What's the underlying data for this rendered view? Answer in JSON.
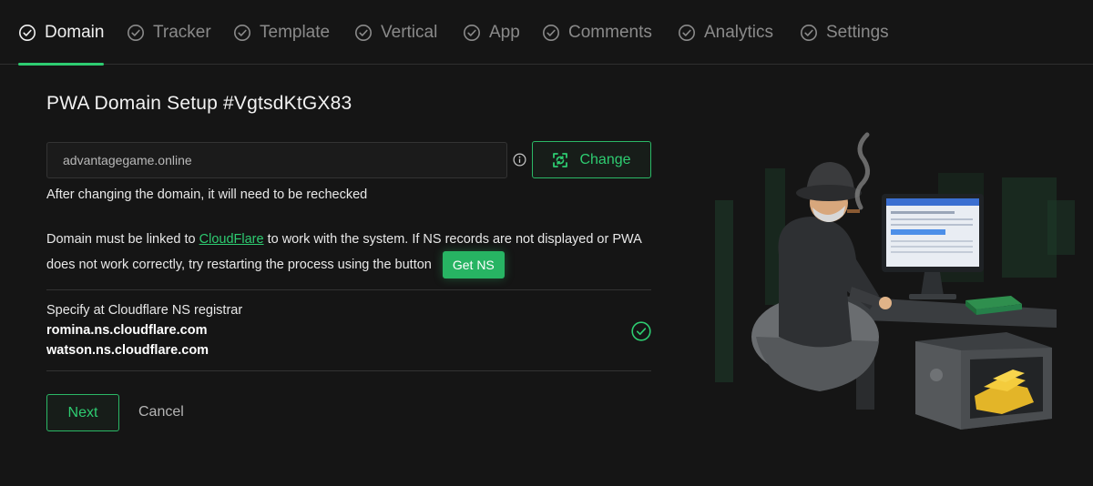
{
  "tabs": [
    {
      "label": "Domain",
      "icon": "check-circle-icon",
      "active": true
    },
    {
      "label": "Tracker",
      "icon": "check-circle-icon",
      "active": false
    },
    {
      "label": "Template",
      "icon": "check-circle-icon",
      "active": false
    },
    {
      "label": "Vertical",
      "icon": "check-circle-icon",
      "active": false
    },
    {
      "label": "App",
      "icon": "check-circle-icon",
      "active": false
    },
    {
      "label": "Comments",
      "icon": "check-circle-icon",
      "active": false
    },
    {
      "label": "Analytics",
      "icon": "check-circle-icon",
      "active": false
    },
    {
      "label": "Settings",
      "icon": "check-circle-icon",
      "active": false
    }
  ],
  "main": {
    "title": "PWA Domain Setup #VgtsdKtGX83",
    "domain_value": "advantagegame.online",
    "change_label": "Change",
    "hint": "After changing the domain, it will need to be rechecked",
    "para_part1": "Domain must be linked to ",
    "cloudflare_link": "CloudFlare",
    "para_part2": " to work with the system. If NS records are not displayed or PWA does not work correctly, try restarting the process using the button",
    "get_ns_label": "Get NS",
    "ns_label": "Specify at Cloudflare NS registrar",
    "ns1": "romina.ns.cloudflare.com",
    "ns2": "watson.ns.cloudflare.com",
    "next_label": "Next",
    "cancel_label": "Cancel"
  },
  "colors": {
    "accent": "#2ecc71",
    "background": "#151515",
    "muted_text": "#8a8a8a"
  }
}
